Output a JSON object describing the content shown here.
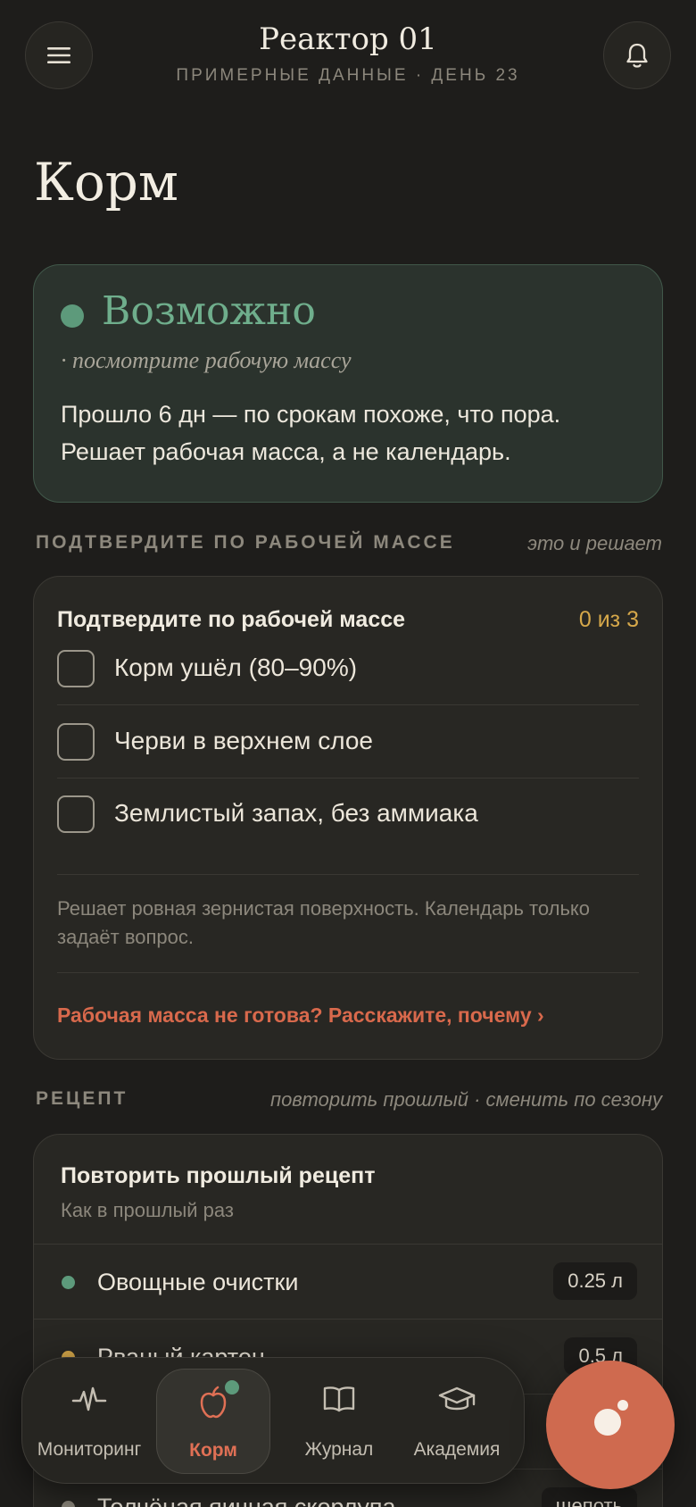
{
  "header": {
    "title": "Реактор 01",
    "subtitle": "ПРИМЕРНЫЕ ДАННЫЕ · ДЕНЬ 23",
    "menu_icon": "menu-icon",
    "notifications_icon": "bell-icon"
  },
  "page": {
    "title": "Корм"
  },
  "status": {
    "word": "Возможно",
    "hint": "· посмотрите рабочую массу",
    "text": "Прошло 6 дн — по срокам похоже, что пора. Решает рабочая масса, а не календарь.",
    "color": "#6fae8c"
  },
  "confirm_section": {
    "label": "ПОДТВЕРДИТЕ ПО РАБОЧЕЙ МАССЕ",
    "note": "это и решает"
  },
  "checklist": {
    "title": "Подтвердите по рабочей массе",
    "count": "0 из 3",
    "items": [
      {
        "label": "Корм ушёл (80–90%)",
        "checked": false
      },
      {
        "label": "Черви в верхнем слое",
        "checked": false
      },
      {
        "label": "Землистый запах, без аммиака",
        "checked": false
      }
    ],
    "note": "Решает ровная зернистая поверхность. Календарь только задаёт вопрос.",
    "link": "Рабочая масса не готова? Расскажите, почему ›"
  },
  "recipe_section": {
    "label": "РЕЦЕПТ",
    "note": "повторить прошлый · сменить по сезону"
  },
  "recipe": {
    "title": "Повторить прошлый рецепт",
    "subtitle": "Как в прошлый раз",
    "ingredients": [
      {
        "label": "Овощные очистки",
        "qty": "0.25 л",
        "color": "#5d9a7b"
      },
      {
        "label": "Рваный картон",
        "qty": "0.5 л",
        "color": "#d6a84a"
      },
      {
        "label": "",
        "qty": "",
        "color": "#8c877c"
      },
      {
        "label": "Толчёная яичная скорлупа",
        "qty": "щепоть",
        "color": "#8c877c"
      }
    ]
  },
  "nav": {
    "items": [
      {
        "label": "Мониторинг",
        "icon": "pulse-icon",
        "active": false
      },
      {
        "label": "Корм",
        "icon": "apple-icon",
        "active": true
      },
      {
        "label": "Журнал",
        "icon": "book-icon",
        "active": false
      },
      {
        "label": "Академия",
        "icon": "graduation-cap-icon",
        "active": false
      }
    ]
  },
  "fab": {
    "icon": "worm-ball-icon"
  },
  "colors": {
    "background": "#1e1d1b",
    "accent": "#cf6a4f",
    "success": "#5d9a7b",
    "warning": "#d6a84a"
  }
}
